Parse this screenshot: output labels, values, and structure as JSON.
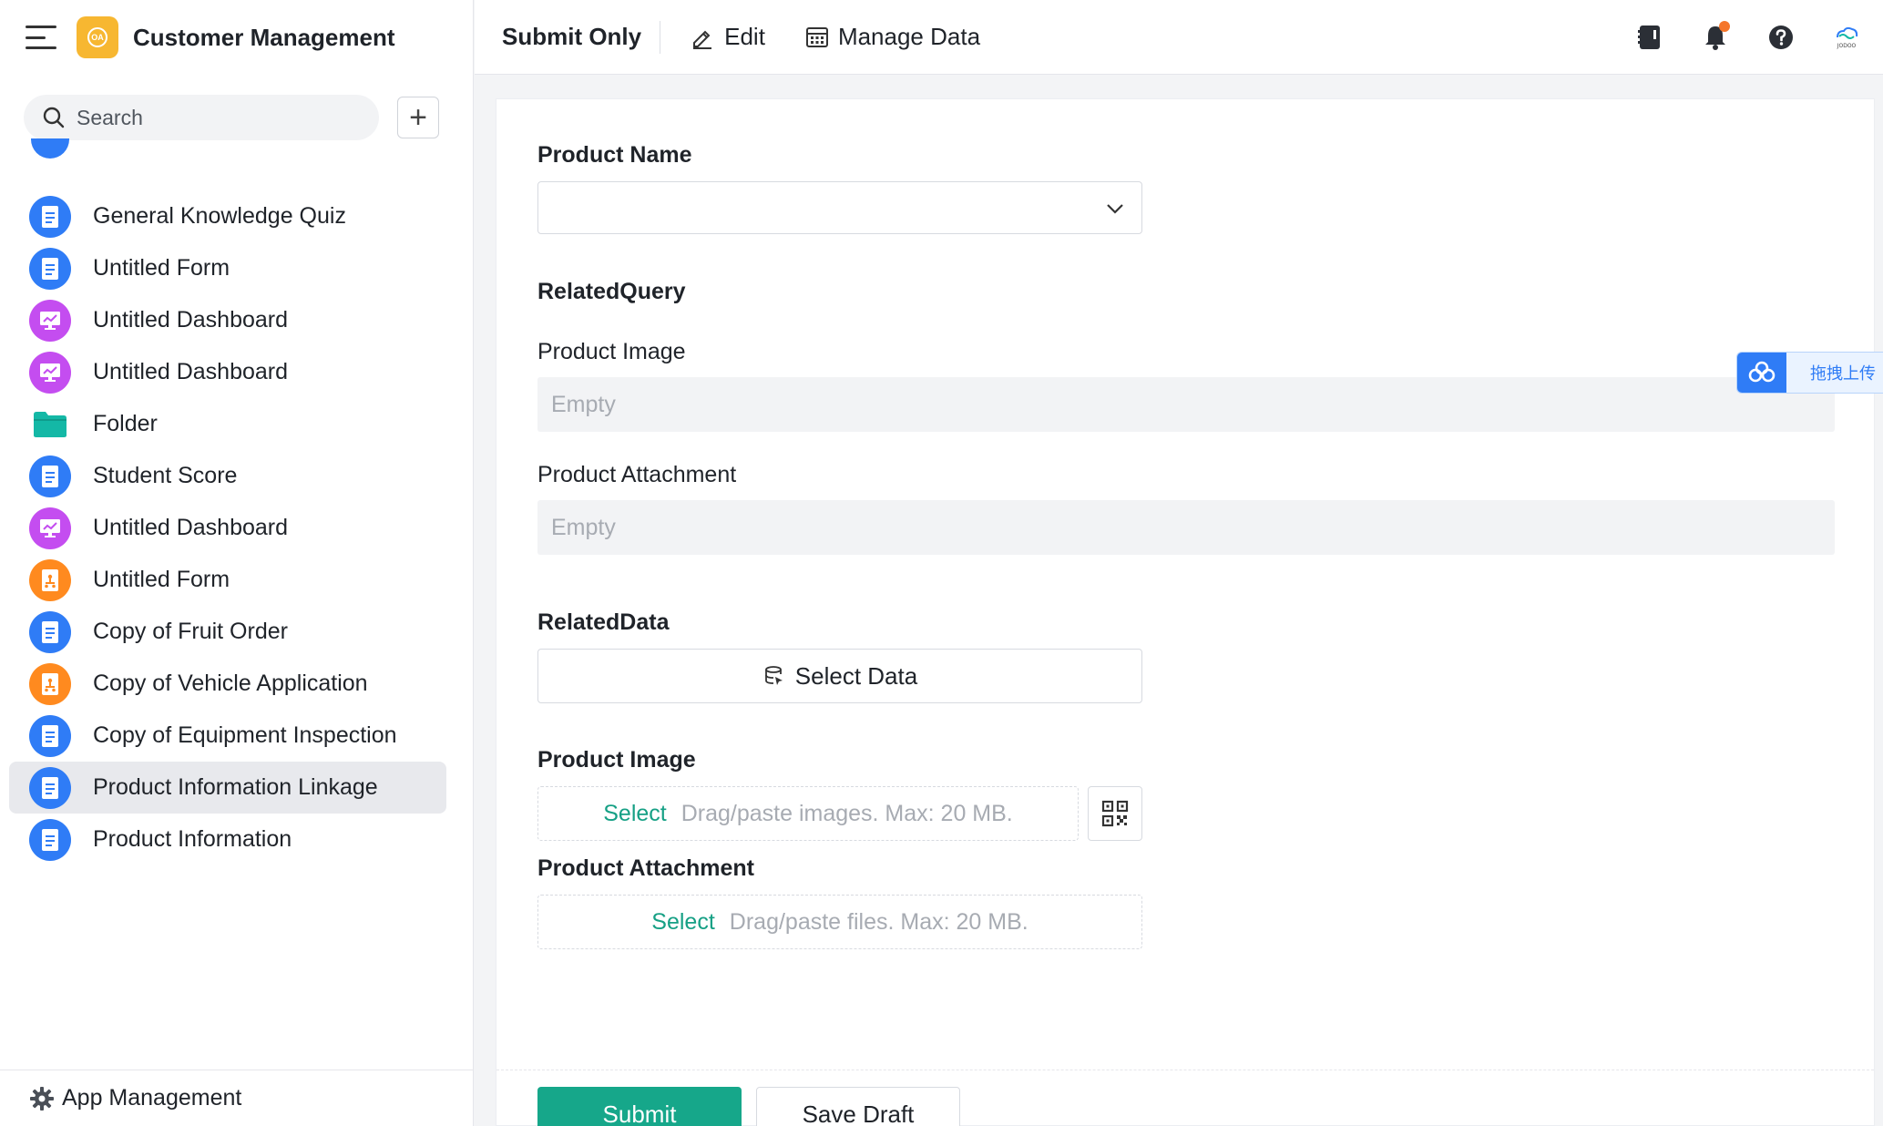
{
  "app": {
    "title": "Customer Management",
    "logo_text": "OA"
  },
  "sidebar": {
    "search_placeholder": "Search",
    "items": [
      {
        "label": "General Knowledge Quiz",
        "icon": "form-icon",
        "color": "#2f7cf6"
      },
      {
        "label": "Untitled Form",
        "icon": "form-icon",
        "color": "#2f7cf6"
      },
      {
        "label": "Untitled Dashboard",
        "icon": "dashboard-icon",
        "color": "#c44df0"
      },
      {
        "label": "Untitled Dashboard",
        "icon": "dashboard-icon",
        "color": "#c44df0"
      },
      {
        "label": "Folder",
        "icon": "folder-icon",
        "color": "#14b8a6"
      },
      {
        "label": "Student Score",
        "icon": "form-icon",
        "color": "#2f7cf6"
      },
      {
        "label": "Untitled Dashboard",
        "icon": "dashboard-icon",
        "color": "#c44df0"
      },
      {
        "label": "Untitled Form",
        "icon": "workflow-form-icon",
        "color": "#ff8a1f"
      },
      {
        "label": "Copy of Fruit Order",
        "icon": "form-icon",
        "color": "#2f7cf6"
      },
      {
        "label": "Copy of Vehicle Application",
        "icon": "workflow-form-icon",
        "color": "#ff8a1f"
      },
      {
        "label": "Copy of Equipment Inspection",
        "icon": "form-icon",
        "color": "#2f7cf6"
      },
      {
        "label": "Product Information Linkage",
        "icon": "form-icon",
        "color": "#2f7cf6",
        "active": true
      },
      {
        "label": "Product Information",
        "icon": "form-icon",
        "color": "#2f7cf6"
      }
    ],
    "footer_label": "App Management"
  },
  "topbar": {
    "submit_only": "Submit Only",
    "edit": "Edit",
    "manage_data": "Manage Data",
    "right_icons": [
      "book-icon",
      "bell-icon",
      "help-icon",
      "jodoo-logo-icon"
    ]
  },
  "form": {
    "product_name_label": "Product Name",
    "product_name_value": "",
    "related_query_label": "RelatedQuery",
    "rq_image_label": "Product Image",
    "rq_image_value": "Empty",
    "rq_attachment_label": "Product Attachment",
    "rq_attachment_value": "Empty",
    "related_data_label": "RelatedData",
    "select_data_button": "Select Data",
    "image_label": "Product Image",
    "image_select": "Select",
    "image_hint": "Drag/paste images. Max: 20 MB.",
    "attachment_label": "Product Attachment",
    "attachment_select": "Select",
    "attachment_hint": "Drag/paste files. Max: 20 MB.",
    "submit_button": "Submit",
    "save_draft_button": "Save Draft"
  },
  "float_widget": {
    "label": "拖拽上传"
  },
  "colors": {
    "accent": "#16a78a",
    "primary_blue": "#2f7cf6",
    "purple": "#c44df0",
    "orange": "#ff8a1f",
    "notification_dot": "#f5762b"
  }
}
